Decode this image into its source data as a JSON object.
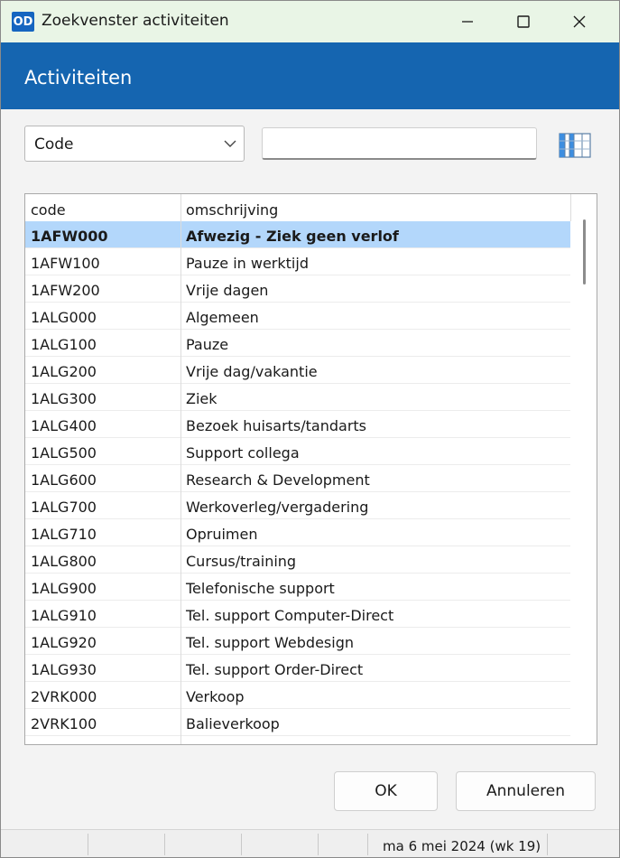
{
  "window": {
    "title": "Zoekvenster activiteiten",
    "app_icon_text": "OD"
  },
  "header": {
    "title": "Activiteiten"
  },
  "search": {
    "field_select_value": "Code",
    "query_value": ""
  },
  "table": {
    "columns": [
      "code",
      "omschrijving"
    ],
    "selected_index": 0,
    "rows": [
      {
        "code": "1AFW000",
        "omschrijving": "Afwezig - Ziek geen verlof"
      },
      {
        "code": "1AFW100",
        "omschrijving": "Pauze in werktijd"
      },
      {
        "code": "1AFW200",
        "omschrijving": "Vrije dagen"
      },
      {
        "code": "1ALG000",
        "omschrijving": "Algemeen"
      },
      {
        "code": "1ALG100",
        "omschrijving": "Pauze"
      },
      {
        "code": "1ALG200",
        "omschrijving": "Vrije dag/vakantie"
      },
      {
        "code": "1ALG300",
        "omschrijving": "Ziek"
      },
      {
        "code": "1ALG400",
        "omschrijving": "Bezoek huisarts/tandarts"
      },
      {
        "code": "1ALG500",
        "omschrijving": "Support collega"
      },
      {
        "code": "1ALG600",
        "omschrijving": "Research & Development"
      },
      {
        "code": "1ALG700",
        "omschrijving": "Werkoverleg/vergadering"
      },
      {
        "code": "1ALG710",
        "omschrijving": "Opruimen"
      },
      {
        "code": "1ALG800",
        "omschrijving": "Cursus/training"
      },
      {
        "code": "1ALG900",
        "omschrijving": "Telefonische support"
      },
      {
        "code": "1ALG910",
        "omschrijving": "Tel. support Computer-Direct"
      },
      {
        "code": "1ALG920",
        "omschrijving": "Tel. support Webdesign"
      },
      {
        "code": "1ALG930",
        "omschrijving": "Tel. support Order-Direct"
      },
      {
        "code": "2VRK000",
        "omschrijving": "Verkoop"
      },
      {
        "code": "2VRK100",
        "omschrijving": "Balieverkoop"
      }
    ]
  },
  "buttons": {
    "ok_label": "OK",
    "cancel_label": "Annuleren"
  },
  "statusbar": {
    "date_text": "ma 6 mei 2024 (wk 19)"
  },
  "colors": {
    "titlebar_bg": "#e9f5e6",
    "header_bg": "#1565b0",
    "selected_row_bg": "#b3d7fb",
    "app_icon_bg": "#1565c0"
  },
  "icons": {
    "app": "od-logo-icon",
    "minimize": "minimize-icon",
    "maximize": "maximize-icon",
    "close": "close-icon",
    "dropdown": "chevron-down-icon",
    "columns": "columns-grid-icon"
  }
}
